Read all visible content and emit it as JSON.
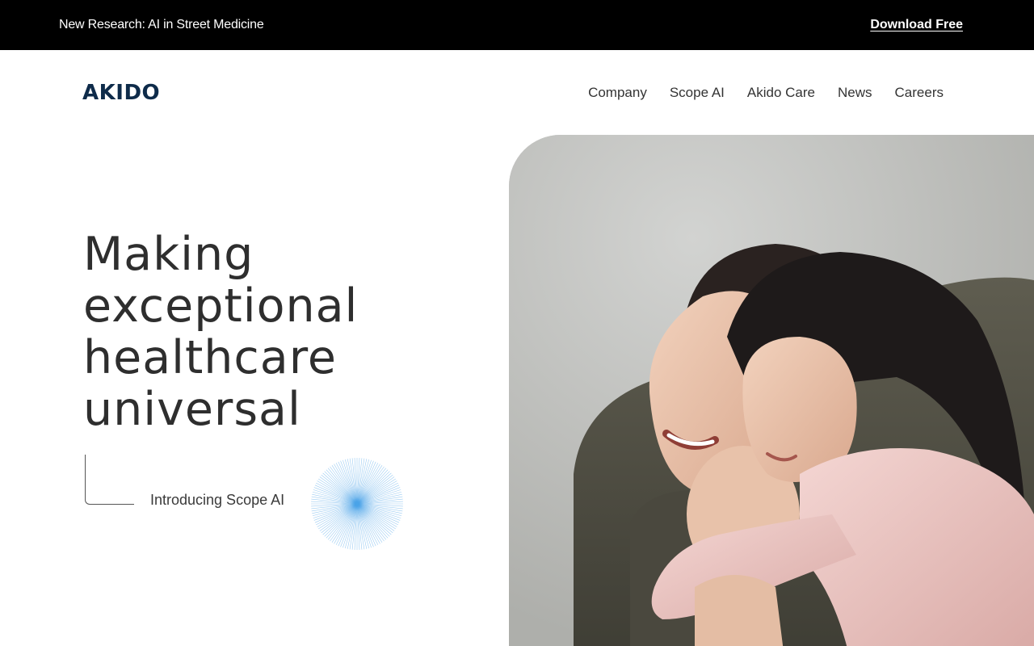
{
  "announcement": {
    "text": "New Research: AI in Street Medicine",
    "cta": "Download Free"
  },
  "header": {
    "logo": "AKIDO",
    "nav": [
      "Company",
      "Scope AI",
      "Akido Care",
      "News",
      "Careers"
    ]
  },
  "hero": {
    "title_lines": [
      "Making",
      "exceptional",
      "healthcare",
      "universal"
    ],
    "scope_link": "Introducing Scope AI",
    "accent_color": "#4aa3e8",
    "image_subject": "woman-and-child-hugging-photo"
  }
}
